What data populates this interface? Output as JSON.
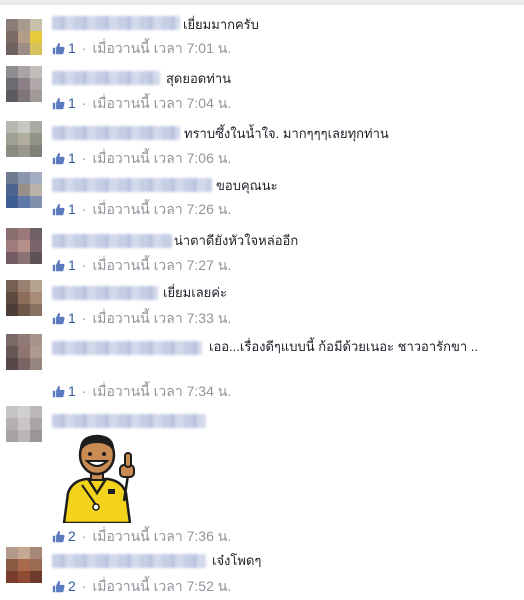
{
  "comments": [
    {
      "text": "เยี่ยมมากครับ",
      "likes": "1",
      "time": "เมื่อวานนี้ เวลา 7:01 น."
    },
    {
      "text": "สุดยอดท่าน",
      "likes": "1",
      "time": "เมื่อวานนี้ เวลา 7:04 น."
    },
    {
      "text": "ทราบซึ้งในน้ำใจ. มากๆๆๆเลยทุกท่าน",
      "likes": "1",
      "time": "เมื่อวานนี้ เวลา 7:06 น."
    },
    {
      "text": "ขอบคุณนะ",
      "likes": "1",
      "time": "เมื่อวานนี้ เวลา 7:26 น."
    },
    {
      "text": "น่าตาดียังหัวใจหล่ออีก",
      "likes": "1",
      "time": "เมื่อวานนี้ เวลา 7:27 น."
    },
    {
      "text": "เยี่ยมเลยค่ะ",
      "likes": "1",
      "time": "เมื่อวานนี้ เวลา 7:33 น."
    },
    {
      "text": "เออ...เรื่องดีๆแบบนี้ ก้อมีด้วยเนอะ ชาวอารักขา ..",
      "likes": "1",
      "time": "เมื่อวานนี้ เวลา 7:34 น."
    },
    {
      "text": "",
      "likes": "2",
      "time": "เมื่อวานนี้ เวลา 7:36 น."
    },
    {
      "text": "เจ๋งโพดๆ",
      "likes": "2",
      "time": "เมื่อวานนี้ เวลา 7:52 น."
    }
  ],
  "colors": {
    "link": "#365899",
    "meta": "#90949c",
    "text": "#1d2129",
    "sticker_shirt": "#f2d21b"
  },
  "icons": {
    "like": "thumbs-up-icon"
  }
}
